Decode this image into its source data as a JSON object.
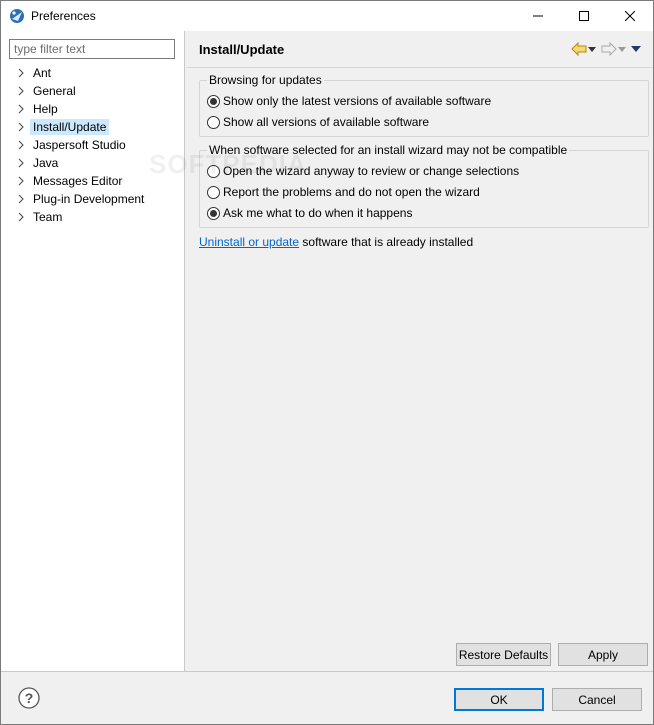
{
  "window": {
    "title": "Preferences",
    "icon": "eclipse-icon",
    "controls": {
      "minimize": "minimize-icon",
      "maximize": "maximize-icon",
      "close": "close-icon"
    }
  },
  "sidebar": {
    "filter_placeholder": "type filter text",
    "items": [
      {
        "label": "Ant",
        "selected": false
      },
      {
        "label": "General",
        "selected": false
      },
      {
        "label": "Help",
        "selected": false
      },
      {
        "label": "Install/Update",
        "selected": true
      },
      {
        "label": "Jaspersoft Studio",
        "selected": false
      },
      {
        "label": "Java",
        "selected": false
      },
      {
        "label": "Messages Editor",
        "selected": false
      },
      {
        "label": "Plug-in Development",
        "selected": false
      },
      {
        "label": "Team",
        "selected": false
      }
    ]
  },
  "page": {
    "title": "Install/Update",
    "nav": {
      "back": "back-arrow-icon",
      "forward": "forward-arrow-icon",
      "menu": "view-menu-icon"
    },
    "browsing_group": {
      "legend": "Browsing for updates",
      "options": [
        {
          "label": "Show only the latest versions of available software",
          "checked": true
        },
        {
          "label": "Show all versions of available software",
          "checked": false
        }
      ]
    },
    "compat_group": {
      "legend": "When software selected for an install wizard may not be compatible",
      "options": [
        {
          "label": "Open the wizard anyway to review or change selections",
          "checked": false
        },
        {
          "label": "Report the problems and do not open the wizard",
          "checked": false
        },
        {
          "label": "Ask me what to do when it happens",
          "checked": true
        }
      ]
    },
    "link_text": "Uninstall or update",
    "link_suffix": " software that is already installed",
    "restore_defaults": "Restore Defaults",
    "apply": "Apply"
  },
  "footer": {
    "help_icon": "help-icon",
    "ok": "OK",
    "cancel": "Cancel"
  },
  "watermark": "SOFTPEDIA",
  "colors": {
    "selection": "#cce8ff",
    "link": "#0066cc",
    "default_button_border": "#0078d7"
  }
}
